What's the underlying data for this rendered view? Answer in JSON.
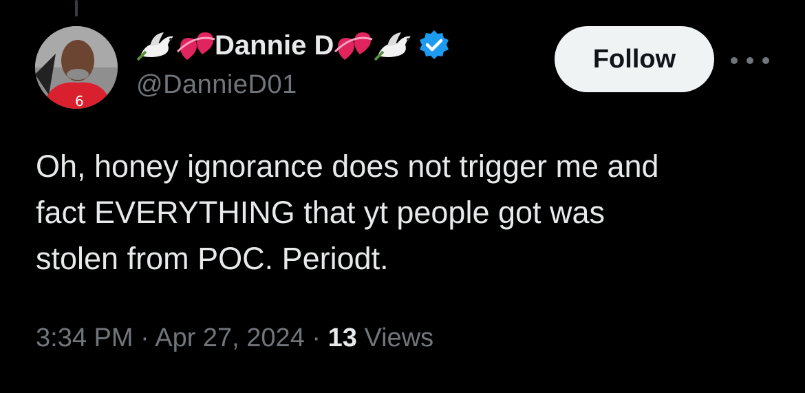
{
  "author": {
    "display_name": "Dannie D",
    "handle": "@DannieD01",
    "verified": true,
    "emojis": [
      "dove-icon",
      "heart-icon",
      "heart-icon",
      "dove-icon"
    ]
  },
  "actions": {
    "follow_label": "Follow",
    "more_icon": "more-icon"
  },
  "tweet": {
    "lines": [
      "Oh, honey ignorance does not trigger me and",
      "fact EVERYTHING that yt people got was",
      "stolen from POC. Periodt."
    ]
  },
  "meta": {
    "time": "3:34 PM",
    "separator": "·",
    "date": "Apr 27, 2024",
    "views_count": "13",
    "views_label": "Views"
  },
  "colors": {
    "background": "#000000",
    "primary_text": "#e7e9ea",
    "secondary_text": "#71767b",
    "verified_blue": "#1d9bf0",
    "follow_bg": "#eff3f4"
  }
}
